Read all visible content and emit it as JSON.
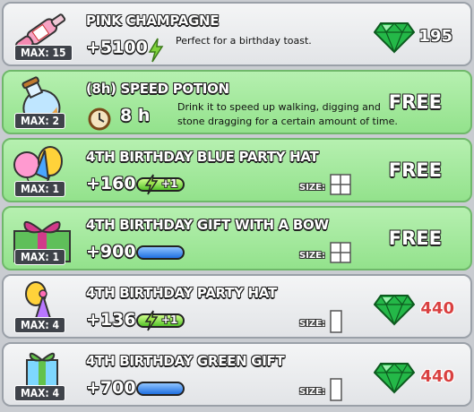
{
  "items": [
    {
      "name": "PINK CHAMPAGNE",
      "max": "MAX: 15",
      "stat": "+5100",
      "description": "Perfect for a birthday toast.",
      "price": "195",
      "currency": "gem"
    },
    {
      "name": "(8h) SPEED POTION",
      "max": "MAX: 2",
      "duration": "8 h",
      "description_line1": "Drink it to speed up walking, digging and",
      "description_line2": "stone dragging for a certain amount of time.",
      "price": "FREE"
    },
    {
      "name": "4TH BIRTHDAY BLUE PARTY HAT",
      "max": "MAX: 1",
      "stat": "+160",
      "badge": "+1",
      "size_label": "SIZE:",
      "price": "FREE"
    },
    {
      "name": "4TH BIRTHDAY GIFT WITH A BOW",
      "max": "MAX: 1",
      "stat": "+900",
      "size_label": "SIZE:",
      "price": "FREE"
    },
    {
      "name": "4TH BIRTHDAY PARTY HAT",
      "max": "MAX: 4",
      "stat": "+136",
      "badge": "+1",
      "size_label": "SIZE:",
      "price": "440",
      "currency": "gem"
    },
    {
      "name": "4TH BIRTHDAY GREEN GIFT",
      "max": "MAX: 4",
      "stat": "+700",
      "size_label": "SIZE:",
      "price": "440",
      "currency": "gem"
    }
  ],
  "colors": {
    "price_red": "#d94040",
    "free_bg": "#93e28c",
    "gem": "#1fae3a"
  }
}
